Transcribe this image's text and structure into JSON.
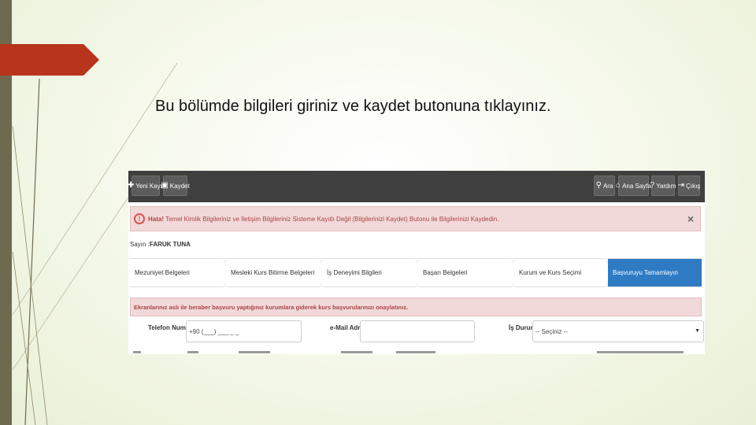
{
  "slide": {
    "instruction": "Bu bölümde bilgileri giriniz ve kaydet butonuna tıklayınız.",
    "accent_color": "#b8341c",
    "sidebar_color": "#6f6a4f"
  },
  "toolbar": {
    "new_record": "Yeni Kayıt",
    "save": "Kaydet",
    "search": "Ara",
    "home": "Ana Sayfa",
    "help": "Yardım",
    "logout": "Çıkış"
  },
  "alert": {
    "prefix": "Hata!",
    "message": "Temel Kimlik Bilgileriniz ve İletişim Bilgileriniz Sisteme Kayıtlı Değil (Bilgilerinizi Kaydet) Butonu ile Bilgilerinizi Kaydedin."
  },
  "user": {
    "label": "Sayın :",
    "name": "FARUK TUNA"
  },
  "steps": [
    {
      "label": "Mezuniyet Belgeleri"
    },
    {
      "label": "Mesleki Kurs Bitirme Belgeleri"
    },
    {
      "label": "İş Deneyimi Bilgileri"
    },
    {
      "label": "Başarı Belgeleri"
    },
    {
      "label": "Kurum ve Kurs Seçimi"
    },
    {
      "label": "Başvuruyu Tamamlayın"
    }
  ],
  "notice": "Ekranlarınız aslı ile beraber başvuru yaptığınız kurumlara giderek kurs başvurularınızı onaylatınız.",
  "form": {
    "phone_label": "Telefon Numarası",
    "phone_value": "+90 (___) ___ _ _",
    "email_label": "e-Mail Adresi",
    "email_value": "",
    "job_label": "İş Durumu",
    "job_value": "-- Seçiniz --"
  }
}
